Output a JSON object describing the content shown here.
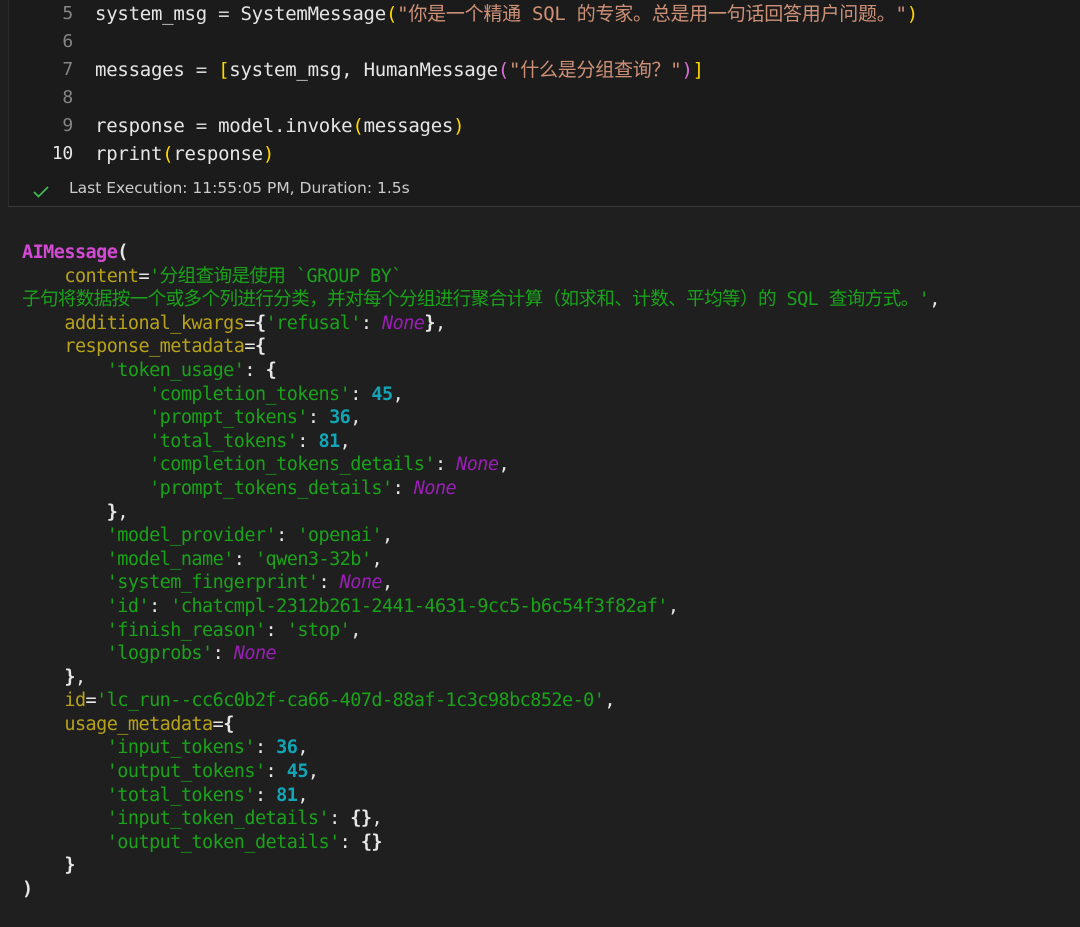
{
  "code_cell": {
    "lines": [
      {
        "num": "5",
        "tokens": [
          {
            "t": "system_msg",
            "c": "v2"
          },
          {
            "t": " = ",
            "c": "op"
          },
          {
            "t": "SystemMessage",
            "c": "v2"
          },
          {
            "t": "(",
            "c": "p1"
          },
          {
            "t": "\"你是一个精通 SQL 的专家。总是用一句话回答用户问题。\"",
            "c": "s"
          },
          {
            "t": ")",
            "c": "p1"
          }
        ]
      },
      {
        "num": "6",
        "tokens": []
      },
      {
        "num": "7",
        "tokens": [
          {
            "t": "messages",
            "c": "v2"
          },
          {
            "t": " = ",
            "c": "op"
          },
          {
            "t": "[",
            "c": "p1"
          },
          {
            "t": "system_msg, HumanMessage",
            "c": "v2"
          },
          {
            "t": "(",
            "c": "p2"
          },
          {
            "t": "\"什么是分组查询？\"",
            "c": "s"
          },
          {
            "t": ")",
            "c": "p2"
          },
          {
            "t": "]",
            "c": "p1"
          }
        ]
      },
      {
        "num": "8",
        "tokens": []
      },
      {
        "num": "9",
        "tokens": [
          {
            "t": "response",
            "c": "v2"
          },
          {
            "t": " = ",
            "c": "op"
          },
          {
            "t": "model.invoke",
            "c": "v2"
          },
          {
            "t": "(",
            "c": "p1"
          },
          {
            "t": "messages",
            "c": "v2"
          },
          {
            "t": ")",
            "c": "p1"
          }
        ]
      },
      {
        "num": "10",
        "tokens": [
          {
            "t": "rprint",
            "c": "v2"
          },
          {
            "t": "(",
            "c": "p1"
          },
          {
            "t": "response",
            "c": "v2"
          },
          {
            "t": ")",
            "c": "p1"
          }
        ],
        "active": true
      }
    ],
    "status_text": "Last Execution: 11:55:05 PM, Duration: 1.5s",
    "status_icon": "check-icon"
  },
  "output": {
    "lines": [
      [
        {
          "t": "AIMessage",
          "c": "cls"
        },
        {
          "t": "(",
          "c": "pun"
        }
      ],
      [
        {
          "t": "    "
        },
        {
          "t": "content",
          "c": "key"
        },
        {
          "t": "=",
          "c": "white"
        },
        {
          "t": "'分组查询是使用 `GROUP BY`",
          "c": "str"
        }
      ],
      [
        {
          "t": "子句将数据按一个或多个列进行分类，并对每个分组进行聚合计算（如求和、计数、平均等）的 SQL 查询方式。'",
          "c": "str"
        },
        {
          "t": ",",
          "c": "white"
        }
      ],
      [
        {
          "t": "    "
        },
        {
          "t": "additional_kwargs",
          "c": "key"
        },
        {
          "t": "=",
          "c": "white"
        },
        {
          "t": "{",
          "c": "pun"
        },
        {
          "t": "'refusal'",
          "c": "str"
        },
        {
          "t": ": ",
          "c": "white"
        },
        {
          "t": "None",
          "c": "none"
        },
        {
          "t": "}",
          "c": "pun"
        },
        {
          "t": ",",
          "c": "white"
        }
      ],
      [
        {
          "t": "    "
        },
        {
          "t": "response_metadata",
          "c": "key"
        },
        {
          "t": "=",
          "c": "white"
        },
        {
          "t": "{",
          "c": "pun"
        }
      ],
      [
        {
          "t": "        "
        },
        {
          "t": "'token_usage'",
          "c": "str"
        },
        {
          "t": ": ",
          "c": "white"
        },
        {
          "t": "{",
          "c": "pun"
        }
      ],
      [
        {
          "t": "            "
        },
        {
          "t": "'completion_tokens'",
          "c": "str"
        },
        {
          "t": ": ",
          "c": "white"
        },
        {
          "t": "45",
          "c": "num"
        },
        {
          "t": ",",
          "c": "white"
        }
      ],
      [
        {
          "t": "            "
        },
        {
          "t": "'prompt_tokens'",
          "c": "str"
        },
        {
          "t": ": ",
          "c": "white"
        },
        {
          "t": "36",
          "c": "num"
        },
        {
          "t": ",",
          "c": "white"
        }
      ],
      [
        {
          "t": "            "
        },
        {
          "t": "'total_tokens'",
          "c": "str"
        },
        {
          "t": ": ",
          "c": "white"
        },
        {
          "t": "81",
          "c": "num"
        },
        {
          "t": ",",
          "c": "white"
        }
      ],
      [
        {
          "t": "            "
        },
        {
          "t": "'completion_tokens_details'",
          "c": "str"
        },
        {
          "t": ": ",
          "c": "white"
        },
        {
          "t": "None",
          "c": "none"
        },
        {
          "t": ",",
          "c": "white"
        }
      ],
      [
        {
          "t": "            "
        },
        {
          "t": "'prompt_tokens_details'",
          "c": "str"
        },
        {
          "t": ": ",
          "c": "white"
        },
        {
          "t": "None",
          "c": "none"
        }
      ],
      [
        {
          "t": "        "
        },
        {
          "t": "}",
          "c": "pun"
        },
        {
          "t": ",",
          "c": "white"
        }
      ],
      [
        {
          "t": "        "
        },
        {
          "t": "'model_provider'",
          "c": "str"
        },
        {
          "t": ": ",
          "c": "white"
        },
        {
          "t": "'openai'",
          "c": "str"
        },
        {
          "t": ",",
          "c": "white"
        }
      ],
      [
        {
          "t": "        "
        },
        {
          "t": "'model_name'",
          "c": "str"
        },
        {
          "t": ": ",
          "c": "white"
        },
        {
          "t": "'qwen3-32b'",
          "c": "str"
        },
        {
          "t": ",",
          "c": "white"
        }
      ],
      [
        {
          "t": "        "
        },
        {
          "t": "'system_fingerprint'",
          "c": "str"
        },
        {
          "t": ": ",
          "c": "white"
        },
        {
          "t": "None",
          "c": "none"
        },
        {
          "t": ",",
          "c": "white"
        }
      ],
      [
        {
          "t": "        "
        },
        {
          "t": "'id'",
          "c": "str"
        },
        {
          "t": ": ",
          "c": "white"
        },
        {
          "t": "'chatcmpl-2312b261-2441-4631-9cc5-b6c54f3f82af'",
          "c": "str"
        },
        {
          "t": ",",
          "c": "white"
        }
      ],
      [
        {
          "t": "        "
        },
        {
          "t": "'finish_reason'",
          "c": "str"
        },
        {
          "t": ": ",
          "c": "white"
        },
        {
          "t": "'stop'",
          "c": "str"
        },
        {
          "t": ",",
          "c": "white"
        }
      ],
      [
        {
          "t": "        "
        },
        {
          "t": "'logprobs'",
          "c": "str"
        },
        {
          "t": ": ",
          "c": "white"
        },
        {
          "t": "None",
          "c": "none"
        }
      ],
      [
        {
          "t": "    "
        },
        {
          "t": "}",
          "c": "pun"
        },
        {
          "t": ",",
          "c": "white"
        }
      ],
      [
        {
          "t": "    "
        },
        {
          "t": "id",
          "c": "key"
        },
        {
          "t": "=",
          "c": "white"
        },
        {
          "t": "'lc_run--cc6c0b2f-ca66-407d-88af-1c3c98bc852e-0'",
          "c": "str"
        },
        {
          "t": ",",
          "c": "white"
        }
      ],
      [
        {
          "t": "    "
        },
        {
          "t": "usage_metadata",
          "c": "key"
        },
        {
          "t": "=",
          "c": "white"
        },
        {
          "t": "{",
          "c": "pun"
        }
      ],
      [
        {
          "t": "        "
        },
        {
          "t": "'input_tokens'",
          "c": "str"
        },
        {
          "t": ": ",
          "c": "white"
        },
        {
          "t": "36",
          "c": "num"
        },
        {
          "t": ",",
          "c": "white"
        }
      ],
      [
        {
          "t": "        "
        },
        {
          "t": "'output_tokens'",
          "c": "str"
        },
        {
          "t": ": ",
          "c": "white"
        },
        {
          "t": "45",
          "c": "num"
        },
        {
          "t": ",",
          "c": "white"
        }
      ],
      [
        {
          "t": "        "
        },
        {
          "t": "'total_tokens'",
          "c": "str"
        },
        {
          "t": ": ",
          "c": "white"
        },
        {
          "t": "81",
          "c": "num"
        },
        {
          "t": ",",
          "c": "white"
        }
      ],
      [
        {
          "t": "        "
        },
        {
          "t": "'input_token_details'",
          "c": "str"
        },
        {
          "t": ": ",
          "c": "white"
        },
        {
          "t": "{}",
          "c": "pun"
        },
        {
          "t": ",",
          "c": "white"
        }
      ],
      [
        {
          "t": "        "
        },
        {
          "t": "'output_token_details'",
          "c": "str"
        },
        {
          "t": ": ",
          "c": "white"
        },
        {
          "t": "{}",
          "c": "pun"
        }
      ],
      [
        {
          "t": "    "
        },
        {
          "t": "}",
          "c": "pun"
        }
      ],
      [
        {
          "t": ")",
          "c": "pun"
        }
      ]
    ]
  },
  "colors": {
    "background": "#1f1f1f",
    "check": "#3fb950"
  }
}
